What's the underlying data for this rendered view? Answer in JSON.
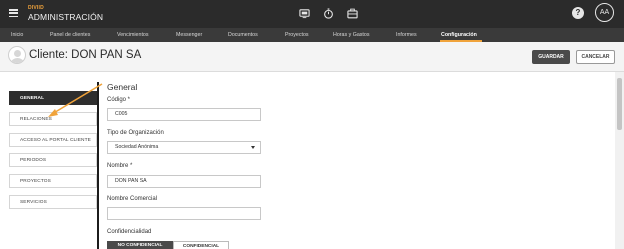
{
  "app": {
    "brand_small": "DIVIID",
    "title": "ADMINISTRACIÓN",
    "user_initials": "AA",
    "help_glyph": "?"
  },
  "toolbar_icons": [
    "monitor-icon",
    "timer-icon",
    "briefcase-icon"
  ],
  "nav": {
    "items": [
      {
        "label": "Inicio"
      },
      {
        "label": "Panel de clientes"
      },
      {
        "label": "Vencimientos"
      },
      {
        "label": "Messenger"
      },
      {
        "label": "Documentos"
      },
      {
        "label": "Proyectos"
      },
      {
        "label": "Horas y Gastos"
      },
      {
        "label": "Informes"
      },
      {
        "label": "Configuración"
      }
    ],
    "active": "Configuración"
  },
  "header": {
    "title": "Cliente: DON PAN SA",
    "save_label": "GUARDAR",
    "cancel_label": "CANCELAR"
  },
  "side_menu": {
    "items": [
      {
        "label": "GENERAL"
      },
      {
        "label": "RELACIONES"
      },
      {
        "label": "ACCESO AL PORTAL CLIENTE"
      },
      {
        "label": "PERIODOS"
      },
      {
        "label": "PROYECTOS"
      },
      {
        "label": "SERVICIOS"
      }
    ],
    "active": "GENERAL"
  },
  "form": {
    "section_title": "General",
    "codigo_label": "Código *",
    "codigo_value": "C005",
    "tipo_label": "Tipo de Organización",
    "tipo_value": "Sociedad Anónima",
    "nombre_label": "Nombre *",
    "nombre_value": "DON PAN SA",
    "nombre_comercial_label": "Nombre Comercial",
    "nombre_comercial_value": "",
    "confidencialidad_label": "Confidencialidad",
    "toggle_no": "NO CONFIDENCIAL",
    "toggle_yes": "CONFIDENCIAL"
  },
  "colors": {
    "topbar": "#2b2b2b",
    "navbar": "#3a3a3a",
    "accent": "#f0a33b",
    "active_dark": "#2e2e2e"
  }
}
